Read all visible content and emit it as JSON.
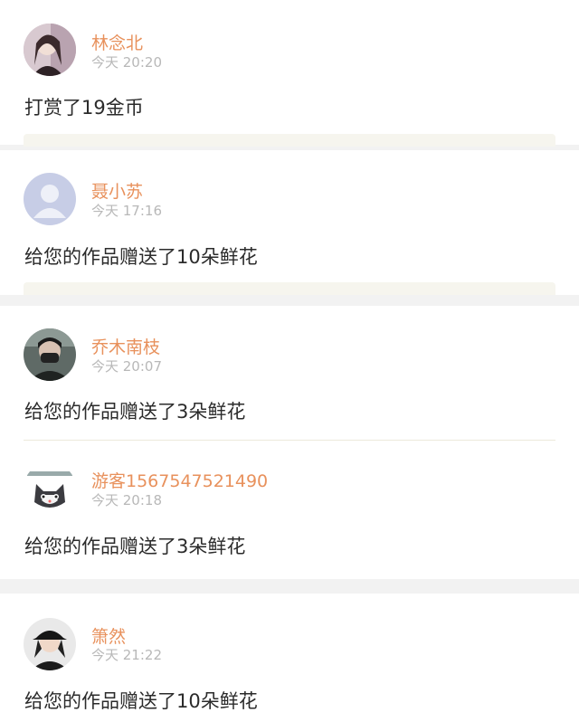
{
  "messages": [
    {
      "name": "林念北",
      "time": "今天 20:20",
      "text": "打赏了19金币",
      "avatar": "avatar-photo-girl"
    },
    {
      "name": "聂小苏",
      "time": "今天 17:16",
      "text": "给您的作品赠送了10朵鲜花",
      "avatar": "default-avatar-icon"
    },
    {
      "name": "乔木南枝",
      "time": "今天 20:07",
      "text": "给您的作品赠送了3朵鲜花",
      "avatar": "avatar-photo-masked-person"
    },
    {
      "name": "游客1567547521490",
      "time": "今天 20:18",
      "text": "给您的作品赠送了3朵鲜花",
      "avatar": "avatar-cartoon-cat"
    },
    {
      "name": "箫然",
      "time": "今天 21:22",
      "text": "给您的作品赠送了10朵鲜花",
      "avatar": "avatar-photo-cap-person"
    }
  ],
  "colors": {
    "name": "#e8915c",
    "time": "#b8b8b8",
    "text": "#2b2b2b",
    "background": "#f2f2f2",
    "card": "#ffffff"
  }
}
